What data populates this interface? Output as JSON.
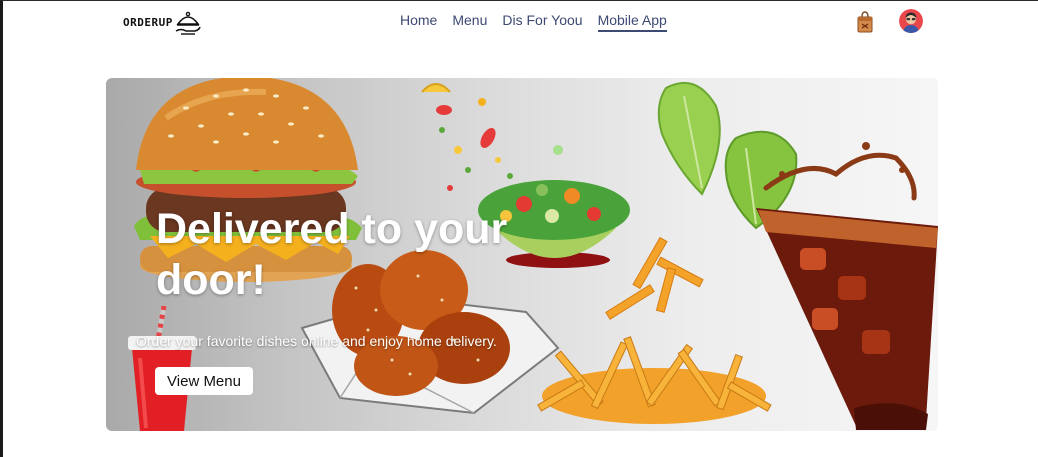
{
  "brand": {
    "name": "ORDERUP"
  },
  "nav": {
    "items": [
      {
        "label": "Home",
        "active": false
      },
      {
        "label": "Menu",
        "active": false
      },
      {
        "label": "Dis For Yoou",
        "active": false
      },
      {
        "label": "Mobile App",
        "active": true
      }
    ]
  },
  "header_icons": {
    "cart": "shopping-bag-icon",
    "profile": "user-avatar"
  },
  "hero": {
    "title": "Delivered to your door!",
    "subtitle": "Order your favorite dishes online and enjoy home delivery.",
    "cta_label": "View Menu"
  },
  "colors": {
    "nav_text": "#3d4a73",
    "hero_text": "#ffffff",
    "button_bg": "#ffffff"
  }
}
